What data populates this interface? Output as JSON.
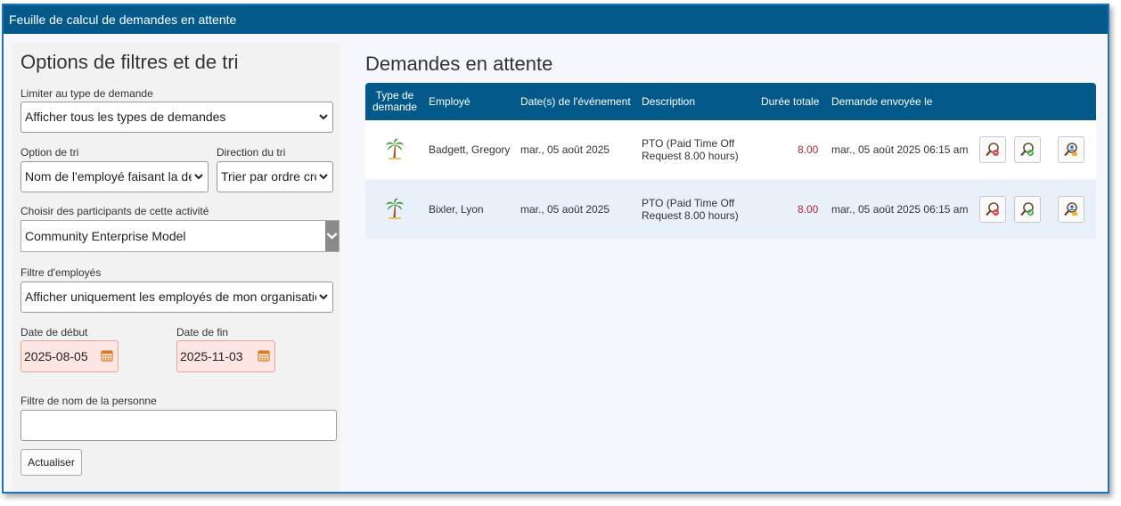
{
  "window": {
    "title": "Feuille de calcul de demandes en attente"
  },
  "filters": {
    "heading": "Options de filtres et de tri",
    "request_type": {
      "label": "Limiter au type de demande",
      "value": "Afficher tous les types de demandes"
    },
    "sort_option": {
      "label": "Option de tri",
      "value": "Nom de l'employé faisant la demande"
    },
    "sort_direction": {
      "label": "Direction du tri",
      "value": "Trier par ordre croissant"
    },
    "participants": {
      "label": "Choisir des participants de cette activité",
      "value": "Community Enterprise Model"
    },
    "employee_filter": {
      "label": "Filtre d'employés",
      "value": "Afficher uniquement les employés de mon organisation"
    },
    "start_date": {
      "label": "Date de début",
      "value": "2025-08-05"
    },
    "end_date": {
      "label": "Date de fin",
      "value": "2025-11-03"
    },
    "name_filter": {
      "label": "Filtre de nom de la personne",
      "value": ""
    },
    "refresh_button": "Actualiser"
  },
  "requests": {
    "heading": "Demandes en attente",
    "columns": {
      "type_line1": "Type de",
      "type_line2": "demande",
      "employee": "Employé",
      "dates": "Date(s) de l'événement",
      "description": "Description",
      "duration": "Durée totale",
      "sent": "Demande envoyée le"
    },
    "rows": [
      {
        "icon": "palm-tree-icon",
        "employee": "Badgett, Gregory",
        "date": "mar., 05 août 2025",
        "desc_line1": "PTO (Paid Time Off",
        "desc_line2": "Request 8.00 hours)",
        "duration": "8.00",
        "sent": "mar., 05 août 2025 06:15 am"
      },
      {
        "icon": "palm-tree-icon",
        "employee": "Bixler, Lyon",
        "date": "mar., 05 août 2025",
        "desc_line1": "PTO (Paid Time Off",
        "desc_line2": "Request 8.00 hours)",
        "duration": "8.00",
        "sent": "mar., 05 août 2025 06:15 am"
      }
    ]
  },
  "colors": {
    "header_blue": "#035a8a",
    "row_alt": "#e8f1fa",
    "duration_red": "#b0263a",
    "date_bg": "#fde6e2"
  }
}
